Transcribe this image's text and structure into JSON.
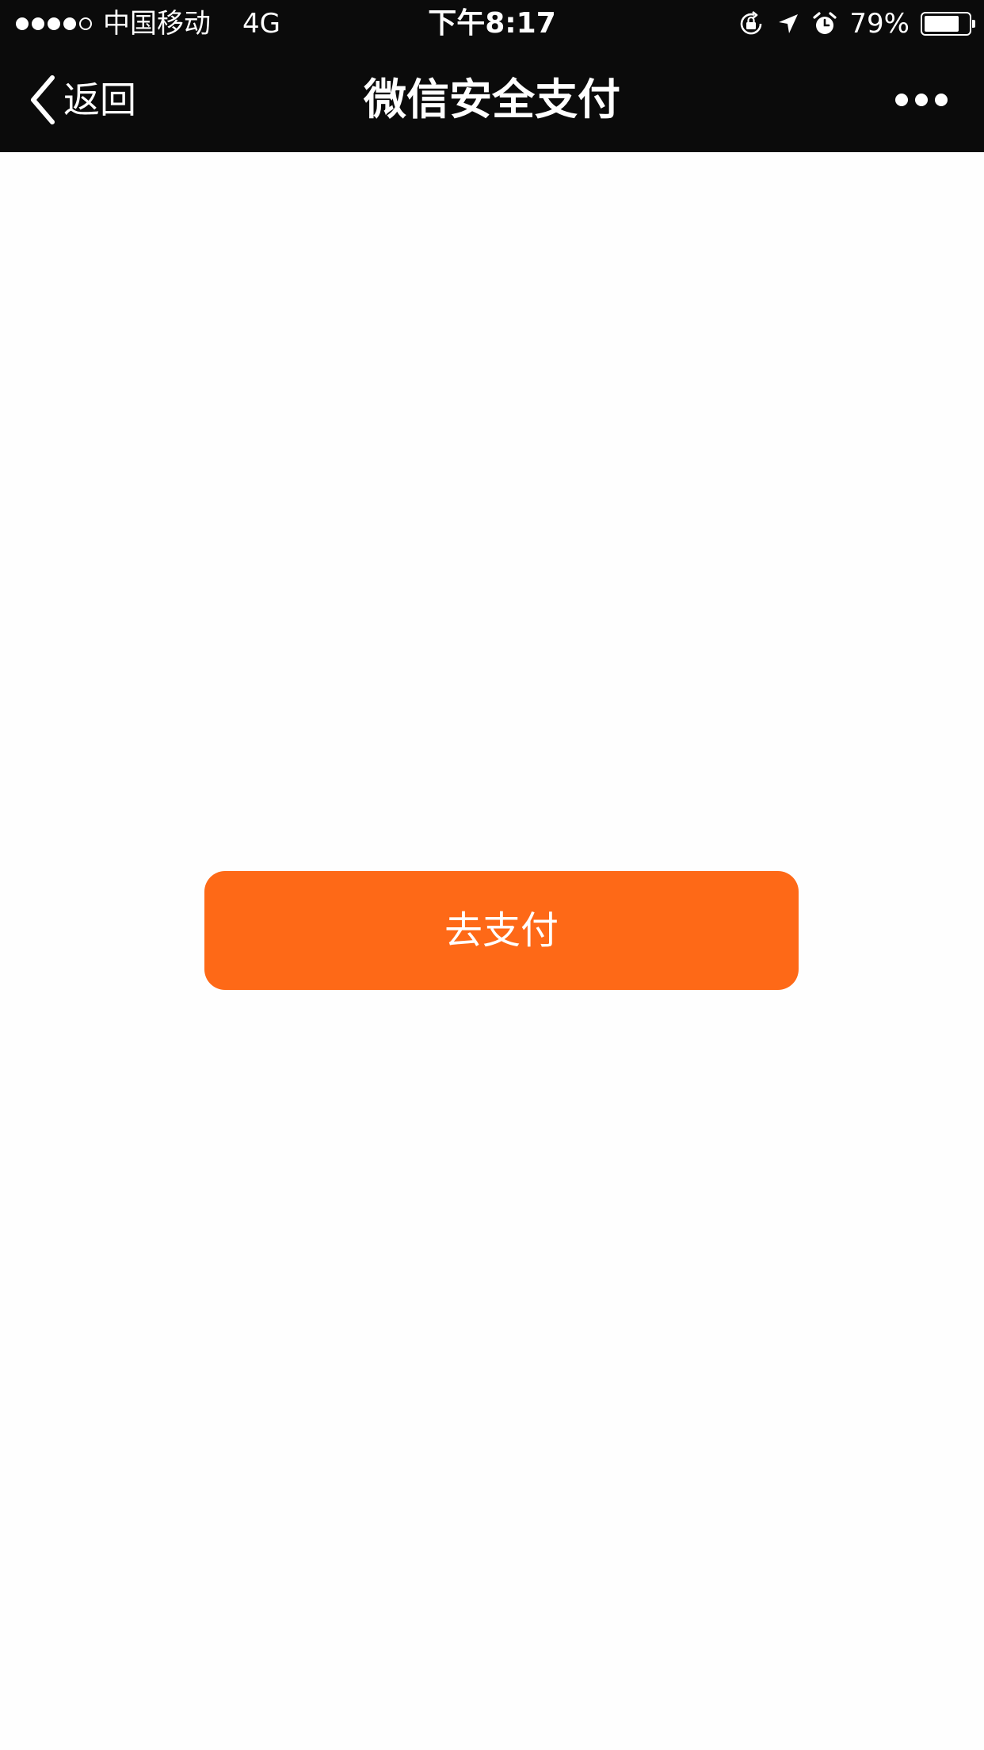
{
  "status_bar": {
    "carrier": "中国移动",
    "network": "4G",
    "time": "下午8:17",
    "battery_percent": "79%",
    "battery_level": 0.79,
    "signal_bars_filled": 4,
    "signal_bars_total": 5,
    "icons": [
      "orientation-lock-icon",
      "location-arrow-icon",
      "alarm-icon",
      "battery-icon"
    ]
  },
  "nav": {
    "back_label": "返回",
    "title": "微信安全支付",
    "back_icon": "chevron-left-icon",
    "more_icon": "more-dots-icon"
  },
  "main": {
    "pay_button_label": "去支付"
  },
  "colors": {
    "bar_background": "#0b0b0b",
    "page_background": "#fefefe",
    "accent": "#fe6917",
    "text_on_dark": "#ffffff"
  }
}
